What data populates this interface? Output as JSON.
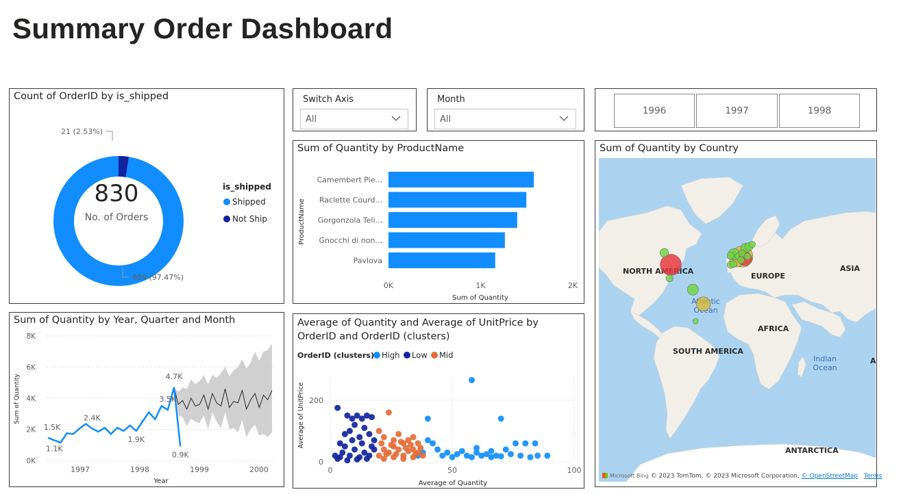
{
  "page": {
    "title": "Summary Order Dashboard"
  },
  "donut": {
    "title": "Count of OrderID by is_shipped",
    "center_value": "830",
    "center_label": "No. of Orders",
    "label_shipped": "809 (97.47%)",
    "label_notship": "21 (2.53%)",
    "legend_title": "is_shipped",
    "legend": [
      {
        "name": "Shipped",
        "color": "#118dff"
      },
      {
        "name": "Not Ship",
        "color": "#12239e"
      }
    ]
  },
  "slicers": {
    "switch_axis": {
      "label": "Switch Axis",
      "value": "All"
    },
    "month": {
      "label": "Month",
      "value": "All"
    }
  },
  "years": [
    "1996",
    "1997",
    "1998"
  ],
  "map": {
    "title": "Sum of Quantity by Country",
    "labels": {
      "north_america": "NORTH AMERICA",
      "europe": "EUROPE",
      "asia": "ASIA",
      "africa": "AFRICA",
      "south_america": "SOUTH AMERICA",
      "antarctica": "ANTARCTICA",
      "atlantic": "Atlantic Ocean",
      "indian": "Indian Ocean"
    },
    "footer": {
      "brand": "Microsoft Bing",
      "copyright": "© 2023 TomTom, © 2023 Microsoft Corporation,",
      "osm": "© OpenStreetMap",
      "terms": "Terms"
    }
  },
  "chart_data": [
    {
      "type": "bar",
      "title": "Sum of Quantity by ProductName",
      "categories": [
        "Camembert Pie...",
        "Raclette Courd...",
        "Gorgonzola Teli...",
        "Gnocchi di non...",
        "Pavlova"
      ],
      "values": [
        1577,
        1496,
        1397,
        1263,
        1158
      ],
      "xlabel": "Sum of Quantity",
      "ylabel": "ProductName",
      "xlim": [
        0,
        2000
      ],
      "xticks": [
        "0K",
        "1K",
        "2K"
      ],
      "color": "#118dff"
    },
    {
      "type": "line",
      "title": "Sum of Quantity by Year, Quarter and Month",
      "xlabel": "Year",
      "ylabel": "Sum of Quantity",
      "ylim": [
        0,
        8000
      ],
      "yticks": [
        "0K",
        "2K",
        "4K",
        "6K",
        "8K"
      ],
      "xticks": [
        "1997",
        "1998",
        "1999",
        "2000"
      ],
      "actual": [
        1460,
        1300,
        1150,
        1750,
        1700,
        2050,
        2350,
        2050,
        1850,
        2100,
        1700,
        2100,
        1900,
        2250,
        1900,
        2500,
        3100,
        2650,
        3500,
        3250,
        4700,
        900
      ],
      "forecast": [
        4700,
        3600,
        3850,
        3300,
        4000,
        3500,
        3600,
        4200,
        3300,
        4300,
        3700,
        3500,
        4600,
        3400,
        3800,
        3700,
        4500,
        3300,
        3900,
        4300,
        3400,
        4200,
        3900,
        4500
      ],
      "band_upper": [
        4700,
        4400,
        4700,
        4600,
        5200,
        4900,
        5100,
        5500,
        4900,
        5500,
        5300,
        5600,
        6000,
        5400,
        5800,
        6000,
        6500,
        5900,
        6300,
        7000,
        6400,
        7000,
        7100,
        7500
      ],
      "band_lower": [
        4700,
        2900,
        2800,
        2200,
        2700,
        2500,
        2400,
        2900,
        2000,
        3100,
        2500,
        2100,
        3100,
        2000,
        2100,
        1800,
        2600,
        1500,
        2000,
        2300,
        1600,
        1700,
        1500,
        1800
      ],
      "data_labels": [
        "1.5K",
        "1.1K",
        "2.4K",
        "1.9K",
        "3.5K",
        "4.7K",
        "0.9K"
      ],
      "color": "#118dff"
    },
    {
      "type": "scatter",
      "title": "Average of Quantity and Average of UnitPrice by OrderID and OrderID (clusters)",
      "legend_title": "OrderID (clusters)",
      "xlabel": "Average of Quantity",
      "ylabel": "Average of UnitPrice",
      "xlim": [
        0,
        100
      ],
      "ylim": [
        0,
        275
      ],
      "xticks": [
        "0",
        "50",
        "100"
      ],
      "yticks": [
        "0",
        "200"
      ],
      "series": [
        {
          "name": "High",
          "color": "#118dff",
          "points": [
            [
              40,
              140
            ],
            [
              58,
              265
            ],
            [
              70,
              140
            ],
            [
              60,
              45
            ],
            [
              72,
              40
            ],
            [
              76,
              60
            ],
            [
              80,
              60
            ],
            [
              84,
              60
            ],
            [
              85,
              20
            ],
            [
              89,
              20
            ],
            [
              62,
              20
            ],
            [
              66,
              15
            ],
            [
              48,
              30
            ],
            [
              52,
              25
            ],
            [
              56,
              20
            ],
            [
              64,
              25
            ],
            [
              68,
              20
            ],
            [
              74,
              25
            ],
            [
              78,
              20
            ],
            [
              44,
              40
            ],
            [
              42,
              60
            ],
            [
              46,
              20
            ],
            [
              54,
              35
            ],
            [
              50,
              15
            ],
            [
              58,
              15
            ],
            [
              70,
              18
            ],
            [
              82,
              15
            ],
            [
              38,
              30
            ],
            [
              36,
              20
            ],
            [
              40,
              70
            ],
            [
              60,
              30
            ],
            [
              66,
              35
            ]
          ]
        },
        {
          "name": "Low",
          "color": "#12239e",
          "points": [
            [
              3,
              175
            ],
            [
              7,
              150
            ],
            [
              9,
              140
            ],
            [
              11,
              150
            ],
            [
              13,
              140
            ],
            [
              15,
              150
            ],
            [
              17,
              145
            ],
            [
              10,
              120
            ],
            [
              14,
              110
            ],
            [
              6,
              90
            ],
            [
              8,
              100
            ],
            [
              12,
              80
            ],
            [
              16,
              90
            ],
            [
              18,
              70
            ],
            [
              4,
              60
            ],
            [
              6,
              50
            ],
            [
              10,
              40
            ],
            [
              14,
              30
            ],
            [
              2,
              20
            ],
            [
              4,
              15
            ],
            [
              8,
              20
            ],
            [
              12,
              15
            ],
            [
              16,
              20
            ],
            [
              18,
              40
            ],
            [
              3,
              10
            ],
            [
              7,
              5
            ],
            [
              11,
              8
            ],
            [
              15,
              10
            ],
            [
              5,
              30
            ],
            [
              9,
              70
            ],
            [
              13,
              60
            ],
            [
              17,
              50
            ]
          ]
        },
        {
          "name": "Mid",
          "color": "#e66c37",
          "points": [
            [
              24,
              160
            ],
            [
              20,
              100
            ],
            [
              22,
              80
            ],
            [
              26,
              70
            ],
            [
              28,
              90
            ],
            [
              30,
              60
            ],
            [
              32,
              70
            ],
            [
              34,
              80
            ],
            [
              36,
              60
            ],
            [
              22,
              40
            ],
            [
              24,
              30
            ],
            [
              26,
              50
            ],
            [
              28,
              40
            ],
            [
              30,
              20
            ],
            [
              32,
              35
            ],
            [
              34,
              15
            ],
            [
              20,
              20
            ],
            [
              22,
              10
            ],
            [
              26,
              15
            ],
            [
              30,
              10
            ],
            [
              34,
              40
            ],
            [
              36,
              30
            ],
            [
              38,
              20
            ],
            [
              21,
              60
            ],
            [
              25,
              55
            ],
            [
              29,
              65
            ],
            [
              33,
              55
            ],
            [
              37,
              45
            ],
            [
              23,
              25
            ],
            [
              27,
              25
            ],
            [
              31,
              45
            ],
            [
              35,
              25
            ]
          ]
        }
      ]
    },
    {
      "type": "scatter",
      "title": "Sum of Quantity by Country",
      "x_label_note": "",
      "points": [
        {
          "lon": -100,
          "lat": 40,
          "value": 9330,
          "color": "#e8363b"
        },
        {
          "lon": -110,
          "lat": 56,
          "value": 1550,
          "color": "#6ed63f"
        },
        {
          "lon": -102,
          "lat": 22,
          "value": 1000,
          "color": "#6ed63f"
        },
        {
          "lon": -66,
          "lat": 7,
          "value": 2500,
          "color": "#6ed63f"
        },
        {
          "lon": -50,
          "lat": -12,
          "value": 4200,
          "color": "#d4b83a"
        },
        {
          "lon": -62,
          "lat": -35,
          "value": 400,
          "color": "#6ed63f"
        },
        {
          "lon": 10,
          "lat": 51,
          "value": 9200,
          "color": "#d4b83a"
        },
        {
          "lon": 2,
          "lat": 47,
          "value": 4500,
          "color": "#d4b83a"
        },
        {
          "lon": -3,
          "lat": 54,
          "value": 2700,
          "color": "#6ed63f"
        },
        {
          "lon": 15,
          "lat": 62,
          "value": 2000,
          "color": "#6ed63f"
        },
        {
          "lon": 20,
          "lat": 64,
          "value": 1400,
          "color": "#6ed63f"
        },
        {
          "lon": 25,
          "lat": 67,
          "value": 900,
          "color": "#6ed63f"
        },
        {
          "lon": 14,
          "lat": 48,
          "value": 4000,
          "color": "#e8363b"
        },
        {
          "lon": 4,
          "lat": 51,
          "value": 1000,
          "color": "#6ed63f"
        },
        {
          "lon": 8,
          "lat": 46,
          "value": 1000,
          "color": "#6ed63f"
        },
        {
          "lon": -8,
          "lat": 40,
          "value": 1000,
          "color": "#6ed63f"
        },
        {
          "lon": -4,
          "lat": 41,
          "value": 1000,
          "color": "#6ed63f"
        },
        {
          "lon": 10,
          "lat": 55,
          "value": 1100,
          "color": "#6ed63f"
        },
        {
          "lon": -8,
          "lat": 52,
          "value": 1100,
          "color": "#6ed63f"
        },
        {
          "lon": 18,
          "lat": 51,
          "value": 1000,
          "color": "#6ed63f"
        }
      ]
    }
  ]
}
